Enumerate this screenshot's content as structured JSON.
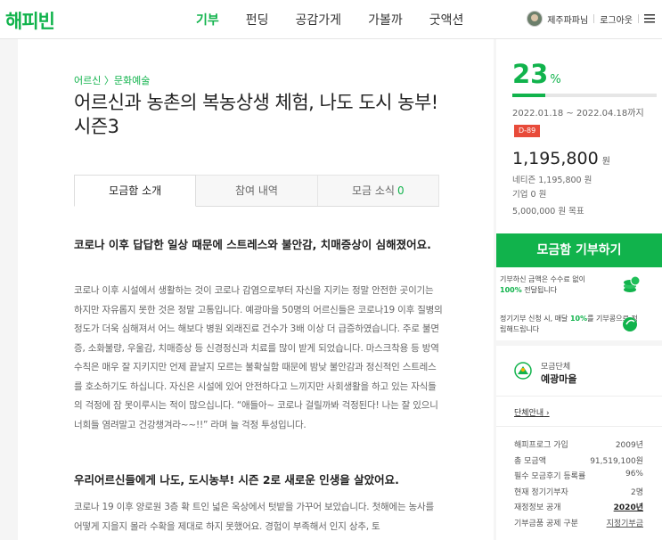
{
  "header": {
    "logo": "해피빈",
    "nav": [
      "기부",
      "펀딩",
      "공감가게",
      "가볼까",
      "굿액션"
    ],
    "user_name": "제주파파님",
    "logout": "로그아웃"
  },
  "main": {
    "category": "어르신 〉문화예술",
    "title": "어르신과 농촌의 복농상생 체험, 나도 도시 농부! 시즌3",
    "tabs": [
      {
        "label": "모금함 소개"
      },
      {
        "label": "참여 내역"
      },
      {
        "label": "모금 소식",
        "count": "0"
      }
    ],
    "section1_heading": "코로나 이후 답답한 일상 때문에 스트레스와 불안감, 치매증상이 심해졌어요.",
    "section1_body": "코로나 이후 시설에서 생활하는 것이 코로나 감염으로부터 자신을 지키는 정말 안전한 곳이기는 하지만 자유롭지 못한 것은 정말 고통입니다. 예광마을 50명의 어르신들은 코로나19 이후 질병의 정도가 더욱 심해져서 어느 해보다 병원 외래진료 건수가 3배 이상 더 급증하였습니다. 주로 불면증, 소화불량, 우울감, 치매증상 등 신경정신과 치료를 많이 받게 되었습니다. 마스크착용 등 방역수칙은 매우 잘 지키지만 언제 끝날지 모르는 불확실함 때문에 밤낮 불안감과 정신적인 스트레스를 호소하기도 하십니다. 자신은 시설에 있어 안전하다고 느끼지만 사회생활을 하고 있는 자식들의 걱정에 잠 못이루시는 적이 많으십니다. “애들아~ 코로나 걸릴까봐 걱정된다! 나는 잘 있으니 너희들 염려말고 건강챙겨라~~!!” 라며 늘 걱정 투성입니다.",
    "section2_heading": "우리어르신들에게 나도, 도시농부! 시즌 2로 새로운 인생을 살았어요.",
    "section2_body": "코로나 19 이후 양로원 3층 확 트인 넓은 옥상에서 텃밭을 가꾸어 보았습니다. 첫해에는 농사를 어떻게 지을지 몰라 수확을 제대로 하지 못했어요. 경험이 부족해서 인지 상추, 토"
  },
  "side": {
    "percent": "23",
    "percent_unit": "%",
    "progress_fraction": 0.23,
    "period": "2022.01.18 ~ 2022.04.18까지",
    "dday": "D-89",
    "amount": "1,195,800",
    "amount_unit": "원",
    "netizen": "네티즌 1,195,800 원",
    "company": "기업 0 원",
    "goal": "5,000,000 원 목표",
    "donate_button": "모금함 기부하기",
    "info1_prefix": "기부하신 금액은 수수료 없이",
    "info1_bold": "100%",
    "info1_suffix": "전달됩니다",
    "info2_prefix": "정기기부 신청 시, 매달",
    "info2_bold": "10%",
    "info2_suffix": "를 기부콩으로 적립해드립니다",
    "org_label": "모금단체",
    "org_name": "예광마을",
    "org_link": "단체안내",
    "org_rows": [
      {
        "k": "해피프로그 가입",
        "v": "2009년"
      },
      {
        "k": "총 모금액",
        "v": "91,519,100원"
      },
      {
        "k": "필수 모금후기 등록률",
        "v": "96%"
      },
      {
        "k": "현재 정기기부자",
        "v": "2명"
      },
      {
        "k": "재정정보 공개",
        "v": "2020년"
      },
      {
        "k": "기부금품 공제 구분",
        "v": "지정기부금"
      }
    ],
    "colors": {
      "brand": "#11b34c",
      "dday": "#e84b3a"
    }
  }
}
